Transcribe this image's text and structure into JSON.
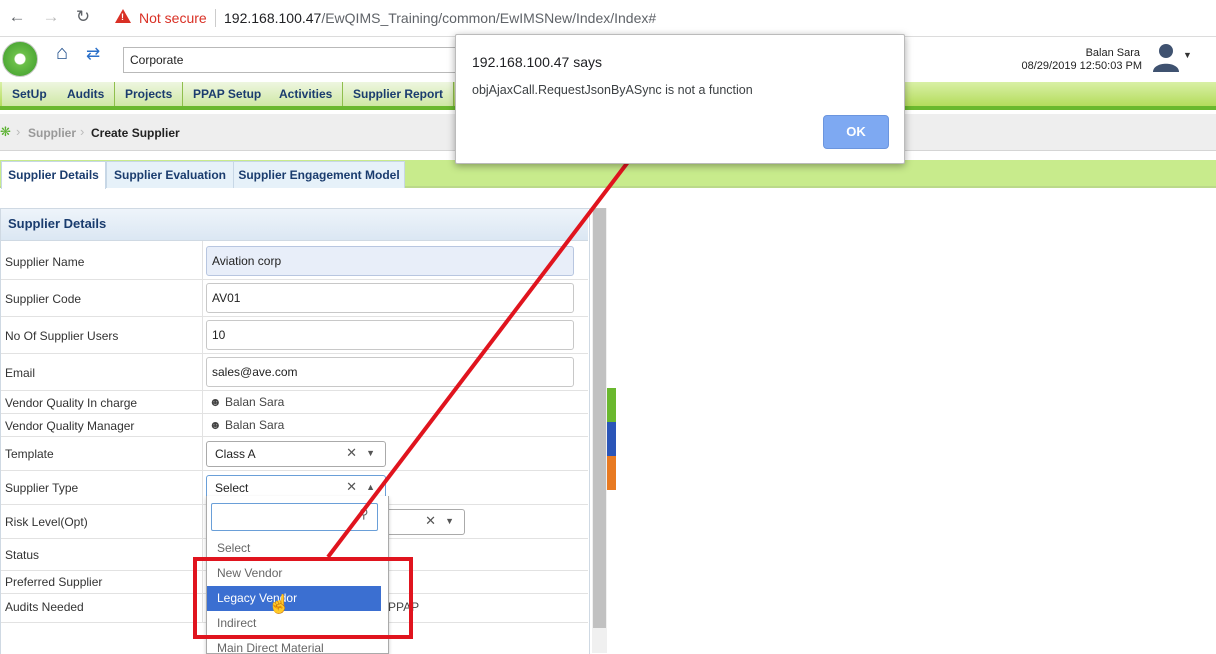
{
  "browser": {
    "security_label": "Not secure",
    "url_host": "192.168.100.47",
    "url_path": "/EwQIMS_Training/common/EwIMSNew/Index/Index#"
  },
  "header": {
    "org_value": "Corporate",
    "user_name": "Balan Sara",
    "datetime": "08/29/2019 12:50:03 PM"
  },
  "menu": {
    "items": [
      "SetUp",
      "Audits",
      "Projects",
      "PPAP Setup",
      "Activities",
      "Supplier Report"
    ]
  },
  "breadcrumb": {
    "parent": "Supplier",
    "current": "Create Supplier"
  },
  "tabs": [
    "Supplier Details",
    "Supplier Evaluation",
    "Supplier Engagement Model"
  ],
  "form": {
    "title": "Supplier Details",
    "supplier_name_label": "Supplier Name",
    "supplier_name_value": "Aviation corp",
    "supplier_code_label": "Supplier Code",
    "supplier_code_value": "AV01",
    "users_label": "No Of Supplier Users",
    "users_value": "10",
    "email_label": "Email",
    "email_value": "sales@ave.com",
    "vqi_label": "Vendor Quality In charge",
    "vqi_value": "Balan Sara",
    "vqm_label": "Vendor Quality Manager",
    "vqm_value": "Balan Sara",
    "template_label": "Template",
    "template_value": "Class A",
    "supplier_type_label": "Supplier Type",
    "supplier_type_value": "Select",
    "risk_label": "Risk Level(Opt)",
    "status_label": "Status",
    "preferred_label": "Preferred Supplier",
    "audits_label": "Audits Needed",
    "audits_partial_text": "PPAP"
  },
  "dropdown": {
    "options": [
      "Select",
      "New Vendor",
      "Legacy Vendor",
      "Indirect",
      "Main Direct Material"
    ],
    "highlighted_index": 2
  },
  "alert": {
    "title": "192.168.100.47 says",
    "message": "objAjaxCall.RequestJsonByASync is not a function",
    "ok_label": "OK"
  },
  "colors": {
    "menu_green": "#b4dc5c",
    "annotation_red": "#e0141e",
    "highlight_blue": "#3b6fd1"
  }
}
